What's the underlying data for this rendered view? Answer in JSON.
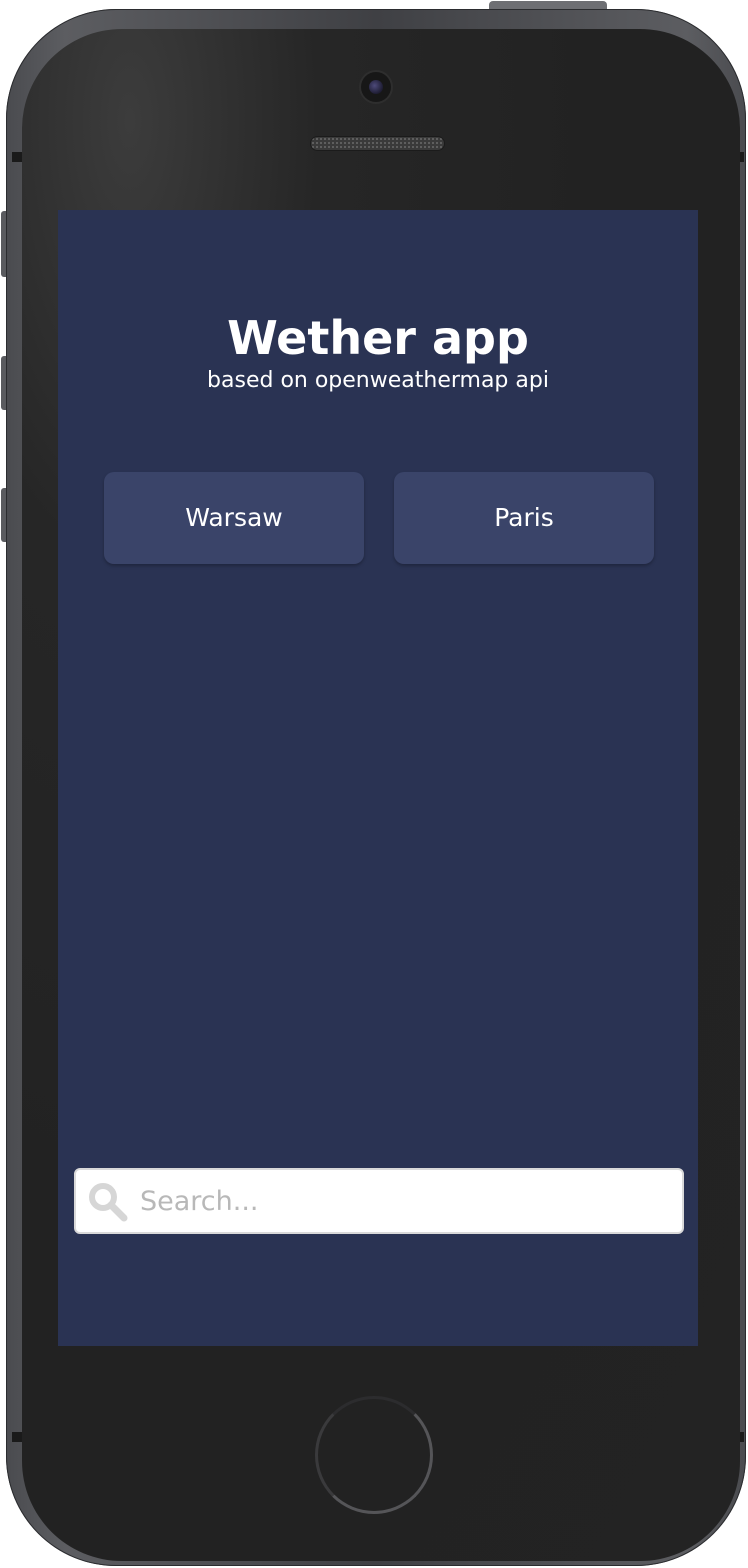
{
  "app": {
    "title": "Wether app",
    "subtitle": "based on openweathermap api"
  },
  "cities": [
    {
      "label": "Warsaw"
    },
    {
      "label": "Paris"
    }
  ],
  "search": {
    "value": "",
    "placeholder": "Search...",
    "icon": "search-icon"
  },
  "colors": {
    "screen_background": "#2a3353",
    "button_background": "#3a4469",
    "text": "#ffffff",
    "placeholder": "#b8b8b8"
  }
}
